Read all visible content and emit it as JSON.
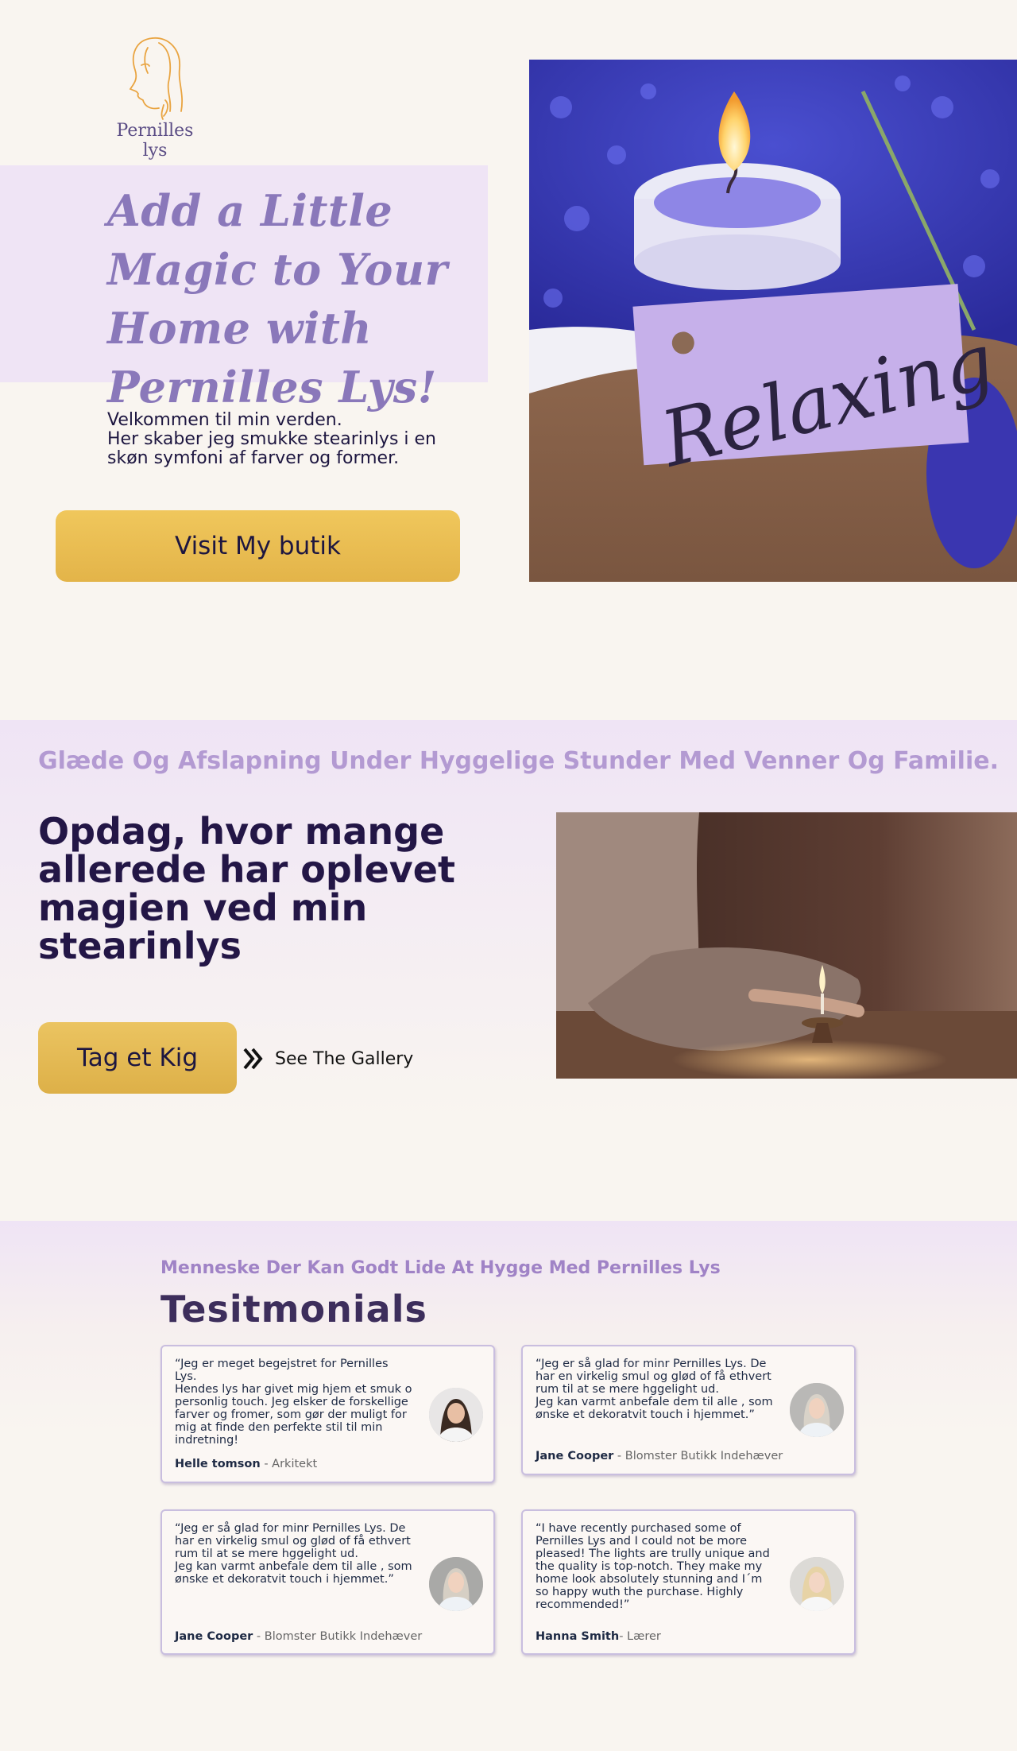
{
  "brand": {
    "name": "Pernilles lys"
  },
  "hero": {
    "title": "Add a Little Magic to Your Home with Pernilles Lys!",
    "text": "Velkommen til min verden.\nHer skaber  jeg smukke stearinlys i en skøn symfoni af farver og former.",
    "button_label": "Visit My butik",
    "image_tag_text": "Relaxing"
  },
  "section2": {
    "tagline": "Glæde Og Afslapning Under Hyggelige Stunder Med Venner Og Familie.",
    "heading": "Opdag, hvor mange allerede har oplevet magien ved min stearinlys",
    "button_label": "Tag et Kig",
    "gallery_link_label": "See The Gallery"
  },
  "testimonials": {
    "tagline": "Menneske Der Kan Godt Lide At Hygge Med Pernilles Lys",
    "heading": "Tesitmonials",
    "items": [
      {
        "quote": "“Jeg er meget begejstret for Pernilles Lys.\nHendes lys har givet mig hjem et  smuk o personlig touch. Jeg elsker de forskellige farver og fromer, som gør der muligt for mig at finde den perfekte stil til min indretning!",
        "name": "Helle tomson",
        "role": " - Arkitekt"
      },
      {
        "quote": "“Jeg  er så glad for minr Pernilles Lys. De har en  virkelig smul og glød of få ethvert rum til at se mere hggelight ud.\nJeg kan varmt anbefale  dem til alle , som ønske et dekoratvit touch i hjemmet.”",
        "name": "Jane Cooper",
        "role": " - Blomster Butikk Indehæver"
      },
      {
        "quote": "“Jeg  er så glad for minr Pernilles Lys. De har en  virkelig smul og glød of få ethvert rum til at se mere hggelight ud.\nJeg kan varmt anbefale  dem til alle , som ønske et dekoratvit touch i hjemmet.”",
        "name": "Jane Cooper",
        "role": " - Blomster Butikk Indehæver"
      },
      {
        "quote": "“I have recently purchased some of Pernilles Lys and I could not  be more pleased! The lights are trully unique and the quality is top-notch. They make my home look absolutely stunning and I´m so happy wuth the purchase. Highly recommended!”",
        "name": "Hanna Smith",
        "role": "- Lærer"
      }
    ]
  },
  "colors": {
    "background": "#f9f5f0",
    "lavender_band": "#efe4f5",
    "accent_gold": "#e8bd55",
    "heading_dark": "#231646",
    "tagline_purple": "#b39ad2"
  }
}
